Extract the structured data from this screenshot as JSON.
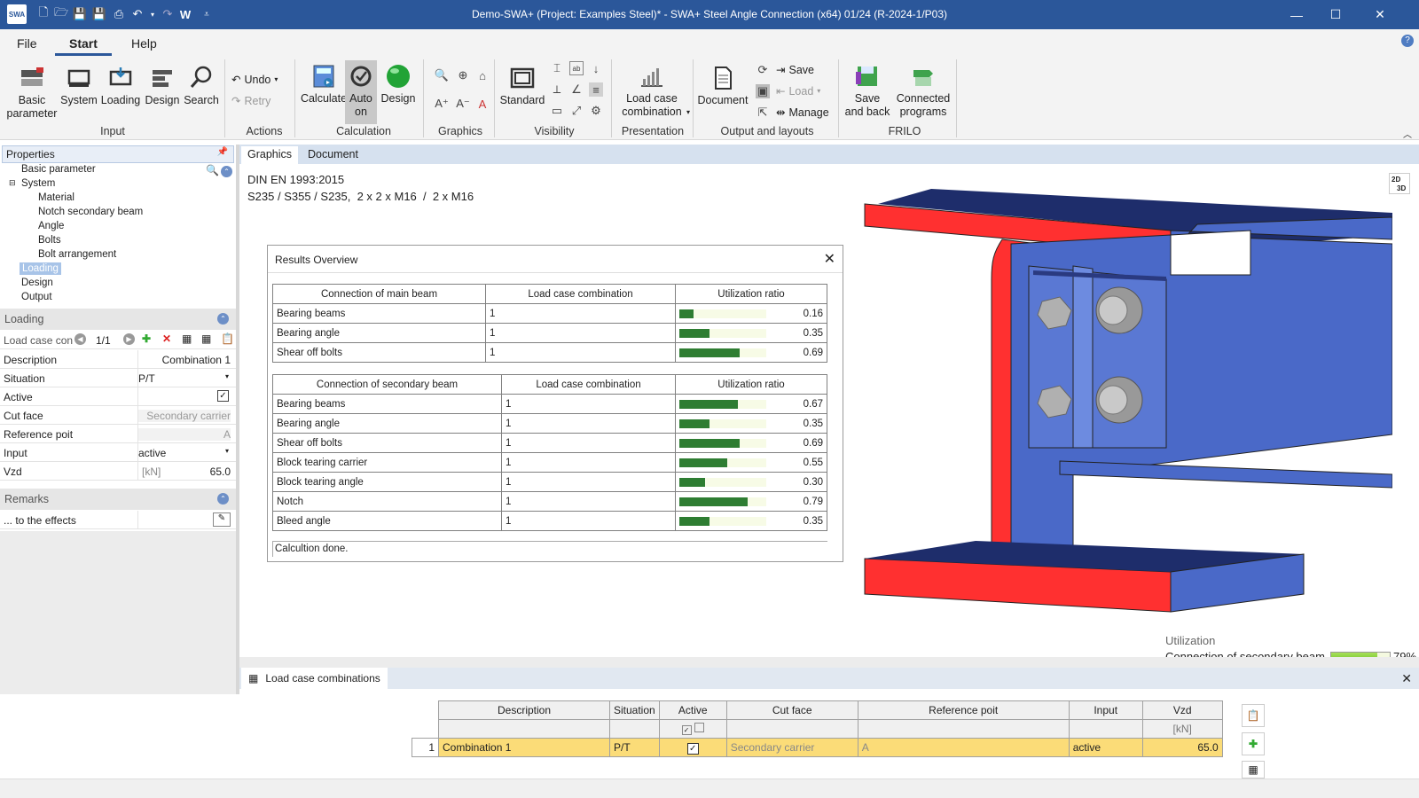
{
  "titlebar": {
    "logo": "SWA",
    "title": "Demo-SWA+ (Project: Examples Steel)* - SWA+ Steel Angle Connection (x64) 01/24 (R-2024-1/P03)",
    "qa_w": "W"
  },
  "tabs": {
    "file": "File",
    "start": "Start",
    "help": "Help"
  },
  "ribbon": {
    "basic_parameter": "Basic\nparameter",
    "system": "System",
    "loading": "Loading",
    "design": "Design",
    "search": "Search",
    "undo": "Undo",
    "retry": "Retry",
    "calculate": "Calculate",
    "auto_on": "Auto\non",
    "design2": "Design",
    "standard": "Standard",
    "load_case_combination": "Load case\ncombination",
    "document": "Document",
    "save": "Save",
    "load": "Load",
    "manage": "Manage",
    "save_and_back": "Save\nand back",
    "connected_programs": "Connected\nprograms",
    "groups": {
      "input": "Input",
      "actions": "Actions",
      "calculation": "Calculation",
      "graphics": "Graphics",
      "visibility": "Visibility",
      "presentation": "Presentation",
      "output": "Output and layouts",
      "frilo": "FRILO"
    }
  },
  "properties": {
    "header": "Properties",
    "tree": [
      "Basic parameter",
      "System",
      "Material",
      "Notch secondary beam",
      "Angle",
      "Bolts",
      "Bolt arrangement",
      "Loading",
      "Design",
      "Output"
    ]
  },
  "loading": {
    "header": "Loading",
    "lcc_label": "Load case con",
    "lcc_page": "1/1",
    "rows": [
      {
        "k": "Description",
        "v": "Combination 1"
      },
      {
        "k": "Situation",
        "v": "P/T"
      },
      {
        "k": "Active",
        "v": ""
      },
      {
        "k": "Cut face",
        "v": "Secondary carrier"
      },
      {
        "k": "Reference poit",
        "v": "A"
      },
      {
        "k": "Input",
        "v": "active"
      },
      {
        "k": "Vzd",
        "unit": "[kN]",
        "v": "65.0"
      }
    ]
  },
  "remarks": {
    "header": "Remarks",
    "effects": "... to the effects"
  },
  "doctabs": {
    "graphics": "Graphics",
    "document": "Document"
  },
  "graphic": {
    "line1": "DIN EN 1993:2015",
    "line2": "S235 / S355 / S235,  2 x 2 x M16  /  2 x M16",
    "view_toggle_2d": "2D",
    "view_toggle_3d": "3D",
    "util_title": "Utilization",
    "util_label": "Connection of secondary beam",
    "util_value": "79%",
    "util_fraction": 0.79
  },
  "results": {
    "title": "Results Overview",
    "main": {
      "headers": [
        "Connection of main beam",
        "Load case combination",
        "Utilization ratio"
      ],
      "rows": [
        {
          "name": "Bearing beams",
          "lc": "1",
          "val": "0.16",
          "frac": 0.16
        },
        {
          "name": "Bearing angle",
          "lc": "1",
          "val": "0.35",
          "frac": 0.35
        },
        {
          "name": "Shear off bolts",
          "lc": "1",
          "val": "0.69",
          "frac": 0.69
        }
      ]
    },
    "secondary": {
      "headers": [
        "Connection of secondary beam",
        "Load case combination",
        "Utilization ratio"
      ],
      "rows": [
        {
          "name": "Bearing beams",
          "lc": "1",
          "val": "0.67",
          "frac": 0.67
        },
        {
          "name": "Bearing angle",
          "lc": "1",
          "val": "0.35",
          "frac": 0.35
        },
        {
          "name": "Shear off bolts",
          "lc": "1",
          "val": "0.69",
          "frac": 0.69
        },
        {
          "name": "Block tearing carrier",
          "lc": "1",
          "val": "0.55",
          "frac": 0.55
        },
        {
          "name": "Block tearing angle",
          "lc": "1",
          "val": "0.30",
          "frac": 0.3
        },
        {
          "name": "Notch",
          "lc": "1",
          "val": "0.79",
          "frac": 0.79
        },
        {
          "name": "Bleed angle",
          "lc": "1",
          "val": "0.35",
          "frac": 0.35
        }
      ]
    },
    "status": "Calcultion done."
  },
  "lcc_table": {
    "tab": "Load case combinations",
    "headers": [
      "Description",
      "Situation",
      "Active",
      "Cut face",
      "Reference poit",
      "Input",
      "Vzd"
    ],
    "unit_row": {
      "vzd": "[kN]"
    },
    "rows": [
      {
        "no": "1",
        "description": "Combination 1",
        "situation": "P/T",
        "cut_face": "Secondary carrier",
        "reference": "A",
        "input": "active",
        "vzd": "65.0"
      }
    ]
  },
  "colors": {
    "accent": "#2b579a",
    "bar": "#2e7d32",
    "highlight": "#fbdc78",
    "beam_red": "#ff3030",
    "beam_blue": "#4a69c8"
  }
}
